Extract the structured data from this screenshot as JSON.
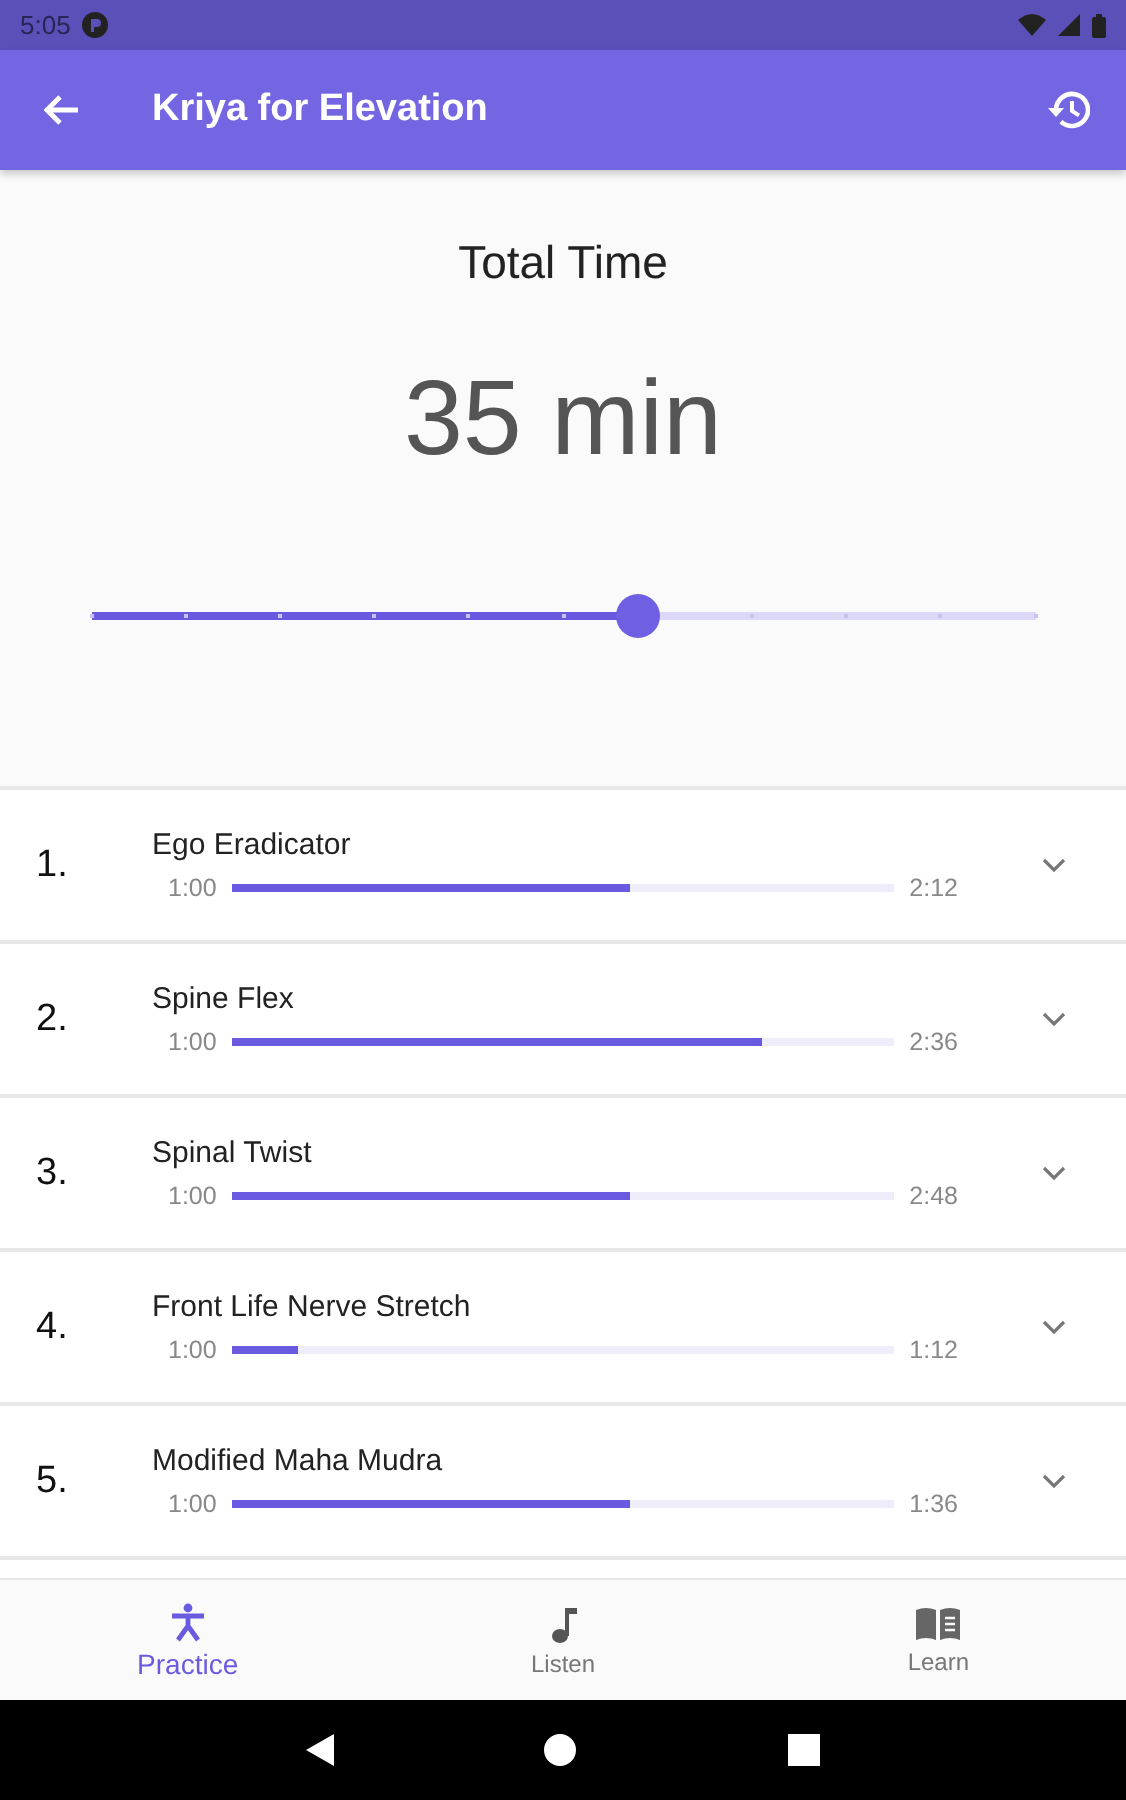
{
  "status_bar": {
    "time": "5:05"
  },
  "app_bar": {
    "title": "Kriya for Elevation"
  },
  "total": {
    "label": "Total Time",
    "value": "35 min",
    "level": 0.58
  },
  "exercises": [
    {
      "number": "1.",
      "name": "Ego Eradicator",
      "min": "1:00",
      "max": "2:12",
      "level": 0.6
    },
    {
      "number": "2.",
      "name": "Spine Flex",
      "min": "1:00",
      "max": "2:36",
      "level": 0.8
    },
    {
      "number": "3.",
      "name": "Spinal Twist",
      "min": "1:00",
      "max": "2:48",
      "level": 0.6
    },
    {
      "number": "4.",
      "name": "Front Life Nerve Stretch",
      "min": "1:00",
      "max": "1:12",
      "level": 0.1
    },
    {
      "number": "5.",
      "name": "Modified Maha Mudra",
      "min": "1:00",
      "max": "1:36",
      "level": 0.6
    }
  ],
  "bottom_nav": [
    {
      "kind": "practice",
      "label": "Practice",
      "selected": true
    },
    {
      "kind": "listen",
      "label": "Listen",
      "selected": false
    },
    {
      "kind": "learn",
      "label": "Learn",
      "selected": false
    }
  ]
}
